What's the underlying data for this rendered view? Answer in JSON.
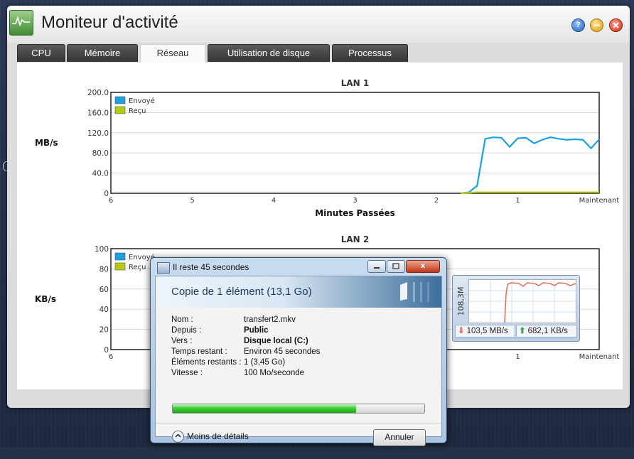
{
  "monitor": {
    "title": "Moniteur d'activité",
    "help_label": "?",
    "tabs": [
      "CPU",
      "Mémoire",
      "Réseau",
      "Utilisation de disque",
      "Processus"
    ],
    "active_tab": "Réseau"
  },
  "chart_data": [
    {
      "type": "line",
      "title": "LAN 1",
      "ylabel": "MB/s",
      "xlabel": "Minutes Passées",
      "ylim": [
        0,
        200
      ],
      "yticks": [
        "200.0",
        "160.0",
        "120.0",
        "80.0",
        "40.0",
        "0"
      ],
      "xticks": [
        "6",
        "5",
        "4",
        "3",
        "2",
        "1",
        "Maintenant"
      ],
      "xlim": [
        6,
        0
      ],
      "legend_position": "top-left",
      "series": [
        {
          "name": "Envoyé",
          "color": "#1aa2e0",
          "x": [
            1.7,
            1.6,
            1.5,
            1.4,
            1.3,
            1.2,
            1.1,
            1.0,
            0.9,
            0.8,
            0.7,
            0.6,
            0.5,
            0.4,
            0.3,
            0.2,
            0.1,
            0.0
          ],
          "values": [
            0,
            2,
            15,
            108,
            111,
            110,
            92,
            109,
            110,
            99,
            106,
            111,
            108,
            106,
            107,
            106,
            89,
            107
          ]
        },
        {
          "name": "Reçu",
          "color": "#b5cc10",
          "x": [
            1.7,
            1.6,
            1.5,
            0.0
          ],
          "values": [
            0,
            1,
            2,
            2
          ]
        }
      ]
    },
    {
      "type": "line",
      "title": "LAN 2",
      "ylabel": "KB/s",
      "ylim": [
        0,
        100
      ],
      "yticks": [
        "100",
        "80",
        "60",
        "40",
        "20",
        "0"
      ],
      "xticks": [
        "6",
        "1",
        "Maintenant"
      ],
      "xlim": [
        6,
        0
      ],
      "legend_position": "top-left",
      "series": [
        {
          "name": "Envoyé",
          "color": "#1aa2e0",
          "values": []
        },
        {
          "name": "Reçu",
          "color": "#b5cc10",
          "values": []
        }
      ]
    }
  ],
  "copy_dialog": {
    "window_title": "Il reste 45 secondes",
    "close_label": "x",
    "header": "Copie de 1 élément (13,1 Go)",
    "rows": [
      {
        "label": "Nom :",
        "value": "transfert2.mkv",
        "bold": false
      },
      {
        "label": "Depuis :",
        "value": "Public",
        "bold": true
      },
      {
        "label": "Vers :",
        "value": "Disque local (C:)",
        "bold": true
      },
      {
        "label": "Temps restant :",
        "value": "Environ 45 secondes",
        "bold": false
      },
      {
        "label": "Éléments restants :",
        "value": "1 (3,45 Go)",
        "bold": false
      },
      {
        "label": "Vitesse :",
        "value": "100 Mo/seconde",
        "bold": false
      }
    ],
    "progress": 0.73,
    "details_label": "Moins de détails",
    "cancel_label": "Annuler"
  },
  "speed_widget": {
    "peak_label": "108,3M",
    "download": "103,5 MB/s",
    "upload": "682,1 KB/s"
  }
}
